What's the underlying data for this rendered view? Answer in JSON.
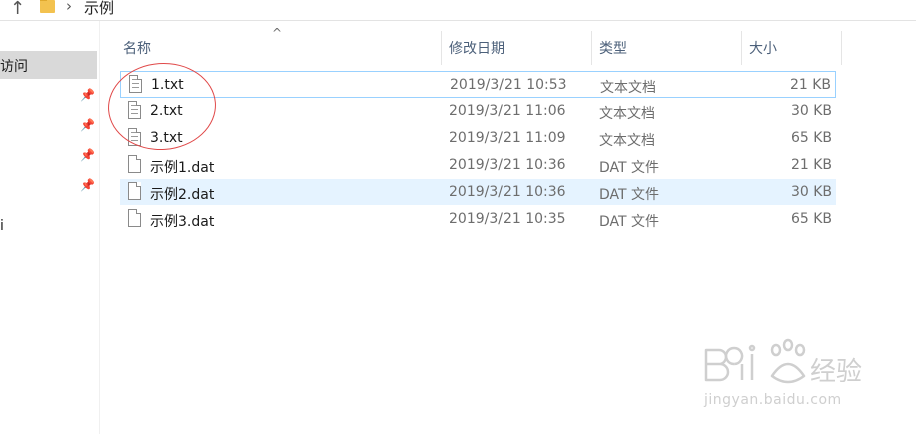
{
  "address": {
    "crumb": "示例"
  },
  "nav": {
    "quick_access": "访问",
    "other": "i"
  },
  "columns": {
    "name": "名称",
    "date": "修改日期",
    "type": "类型",
    "size": "大小"
  },
  "files": [
    {
      "name": "1.txt",
      "date": "2019/3/21 10:53",
      "type": "文本文档",
      "size": "21 KB",
      "kind": "text"
    },
    {
      "name": "2.txt",
      "date": "2019/3/21 11:06",
      "type": "文本文档",
      "size": "30 KB",
      "kind": "text"
    },
    {
      "name": "3.txt",
      "date": "2019/3/21 11:09",
      "type": "文本文档",
      "size": "65 KB",
      "kind": "text"
    },
    {
      "name": "示例1.dat",
      "date": "2019/3/21 10:36",
      "type": "DAT 文件",
      "size": "21 KB",
      "kind": "blank"
    },
    {
      "name": "示例2.dat",
      "date": "2019/3/21 10:36",
      "type": "DAT 文件",
      "size": "30 KB",
      "kind": "blank"
    },
    {
      "name": "示例3.dat",
      "date": "2019/3/21 10:35",
      "type": "DAT 文件",
      "size": "65 KB",
      "kind": "blank"
    }
  ],
  "watermark": {
    "logo": "Baidu经验",
    "url": "jingyan.baidu.com"
  },
  "colors": {
    "selection": "#e5f3ff",
    "focus_border": "#99d1ff",
    "annotation": "#e04848",
    "header_text": "#4c607a"
  }
}
